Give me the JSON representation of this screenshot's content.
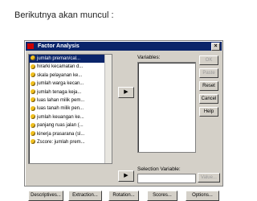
{
  "caption": "Berikutnya akan muncul :",
  "dialog": {
    "title": "Factor Analysis",
    "variables": [
      "jumlah preman/cal...",
      "hirarki kecamatan d...",
      "skala pelayanan ke...",
      "jumlah warga kecan...",
      "jumlah tenaga keja...",
      "luas lahan milik pem...",
      "luas tanah milik pen...",
      "jumlah keuangan ke...",
      "panjang ruas jalan (...",
      "kinerja prasarana (sl...",
      "Zscore: jumlah prem..."
    ],
    "variables_label": "Variables:",
    "selection_label": "Selection Variable:",
    "value_button": "Value...",
    "right_buttons": [
      "OK",
      "Paste",
      "Reset",
      "Cancel",
      "Help"
    ],
    "bottom_buttons": [
      "Descriptives...",
      "Extraction...",
      "Rotation...",
      "Scores...",
      "Options..."
    ]
  }
}
